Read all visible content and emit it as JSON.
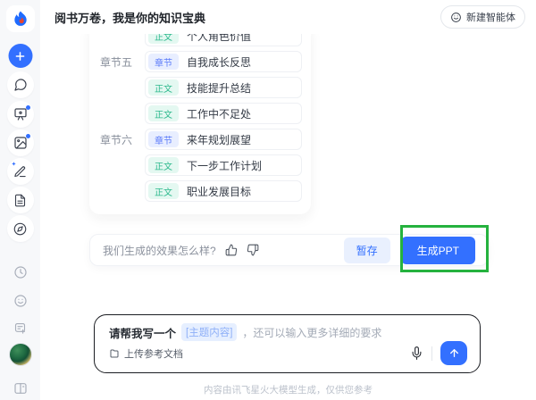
{
  "header": {
    "title": "阅书万卷，我是你的知识宝典",
    "new_agent_button": "新建智能体"
  },
  "sidebar": {
    "icons": [
      "spark-logo",
      "new-chat-plus",
      "chat",
      "ppt-create",
      "image-create",
      "ai-writing",
      "notes",
      "explore",
      "history",
      "feedback-smiley",
      "new-doc",
      "user-avatar",
      "collapse-sidebar"
    ]
  },
  "outline": {
    "rows": [
      {
        "section_label": "",
        "badge": "正文",
        "type": "body",
        "title": "个人角色价值"
      },
      {
        "section_label": "章节五",
        "badge": "章节",
        "type": "chapter",
        "title": "自我成长反思"
      },
      {
        "section_label": "",
        "badge": "正文",
        "type": "body",
        "title": "技能提升总结"
      },
      {
        "section_label": "",
        "badge": "正文",
        "type": "body",
        "title": "工作中不足处"
      },
      {
        "section_label": "章节六",
        "badge": "章节",
        "type": "chapter",
        "title": "来年规划展望"
      },
      {
        "section_label": "",
        "badge": "正文",
        "type": "body",
        "title": "下一步工作计划"
      },
      {
        "section_label": "",
        "badge": "正文",
        "type": "body",
        "title": "职业发展目标"
      }
    ]
  },
  "feedback": {
    "question": "我们生成的效果怎么样?",
    "save_button": "暂存",
    "generate_button": "生成PPT"
  },
  "composer": {
    "prompt_prefix": "请帮我写一个",
    "prompt_chip": "[主题内容]",
    "prompt_suffix": "，还可以输入更多详细的要求",
    "upload_label": "上传参考文档"
  },
  "footer": {
    "disclaimer": "内容由讯飞星火大模型生成，仅供您参考"
  },
  "colors": {
    "accent_blue": "#3370ff",
    "annotation_green": "#25b23e",
    "badge_chapter_bg": "#e8eeff",
    "badge_chapter_text": "#5b7bfa",
    "badge_body_bg": "#e4f8f1",
    "badge_body_text": "#2db98d"
  }
}
